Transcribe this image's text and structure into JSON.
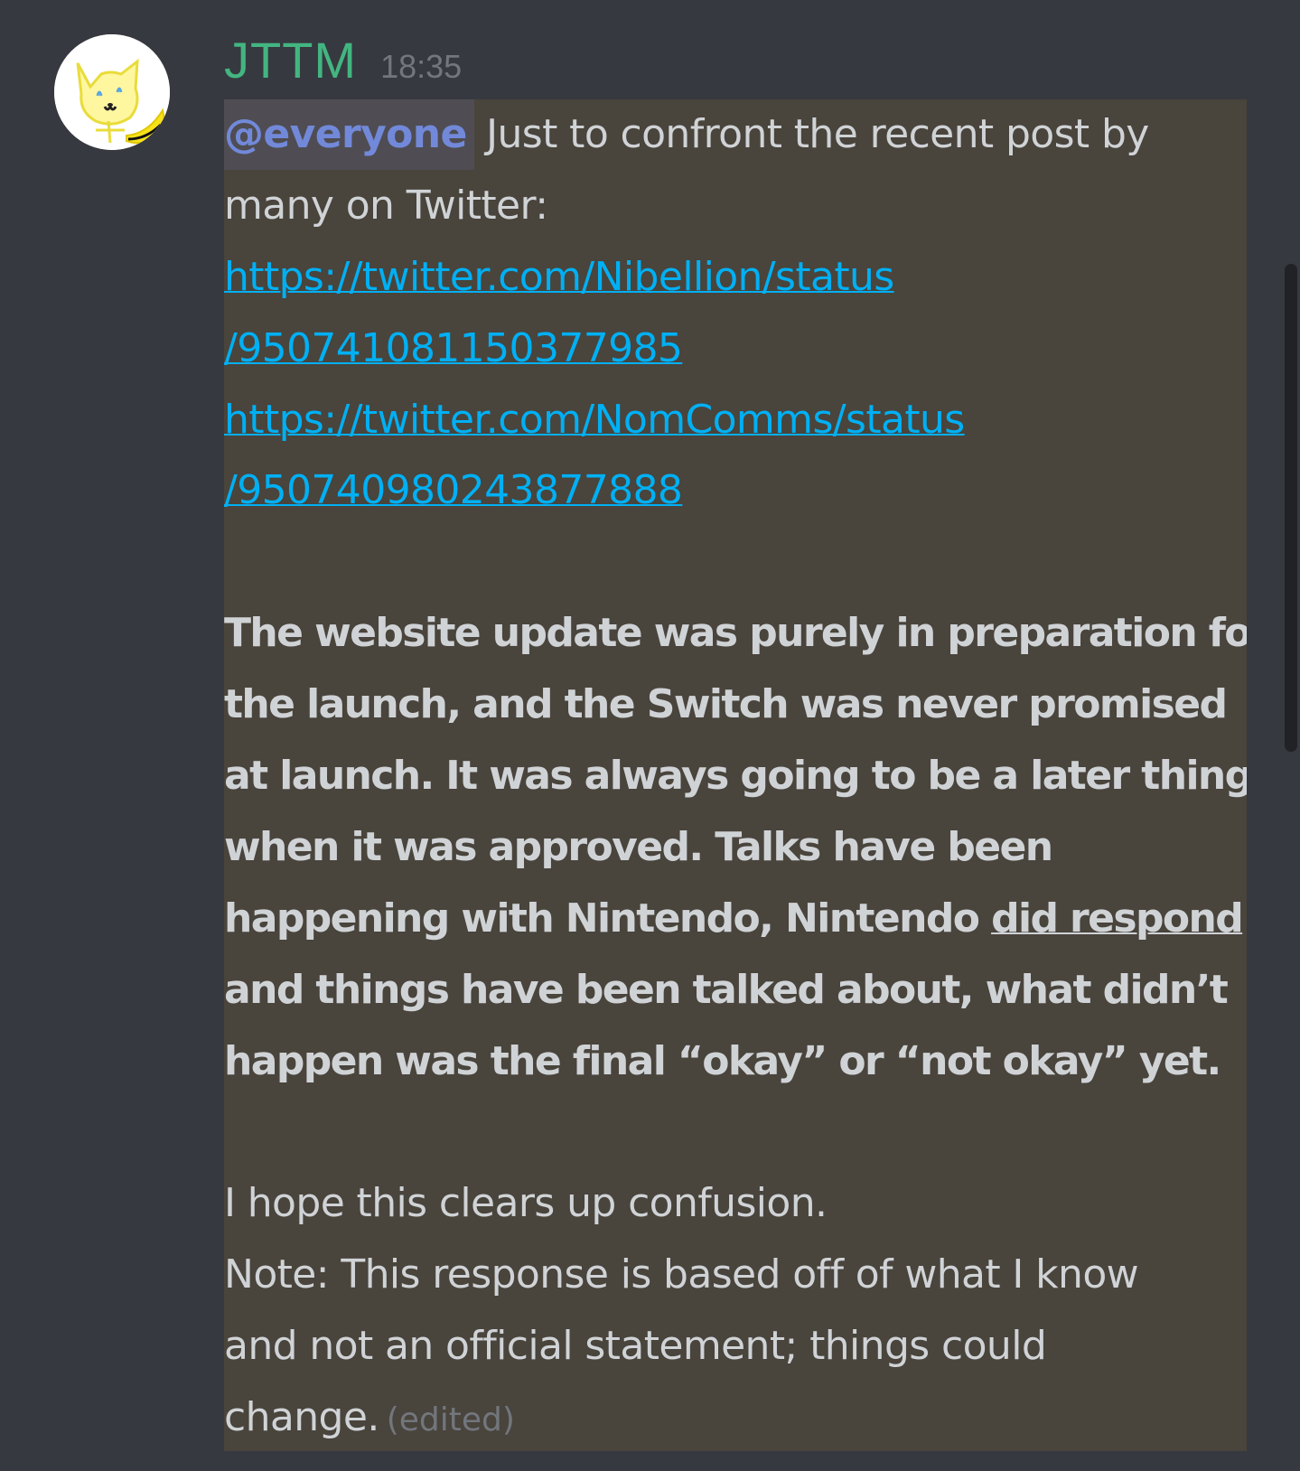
{
  "author": {
    "username": "JTTM",
    "timestamp": "18:35",
    "avatar_icon": "cartoon-cat-avatar"
  },
  "message": {
    "mention": "@everyone",
    "intro_line1": " Just to confront the recent post by",
    "intro_line2": "many on Twitter:",
    "link1_part1": "https://twitter.com/Nibellion/status",
    "link1_part2": "/950741081150377985",
    "link2_part1": "https://twitter.com/NomComms/status",
    "link2_part2": "/950740980243877888",
    "bold_line1": "The website update was purely in preparation for",
    "bold_line2": "the launch, and the Switch was never promised",
    "bold_line3": "at launch. It was always going to be a later thing",
    "bold_line4": "when it was approved. Talks have been",
    "bold_line5_prefix": "happening with Nintendo, Nintendo ",
    "bold_line5_underline": "did respond",
    "bold_line6": "and things have been talked about, what didn’t",
    "bold_line7": "happen was the final “okay” or “not okay” yet.",
    "closing_line1": "I hope this clears up confusion.",
    "note_line1": "Note: This response is based off of what I know",
    "note_line2": "and not an official statement; things could",
    "note_line3": "change.",
    "edited_label": "(edited)"
  },
  "colors": {
    "background": "#36393f",
    "highlight": "#49443c",
    "username": "#43b581",
    "mention": "#7289da",
    "link": "#00b0f4",
    "muted": "#72767d"
  }
}
